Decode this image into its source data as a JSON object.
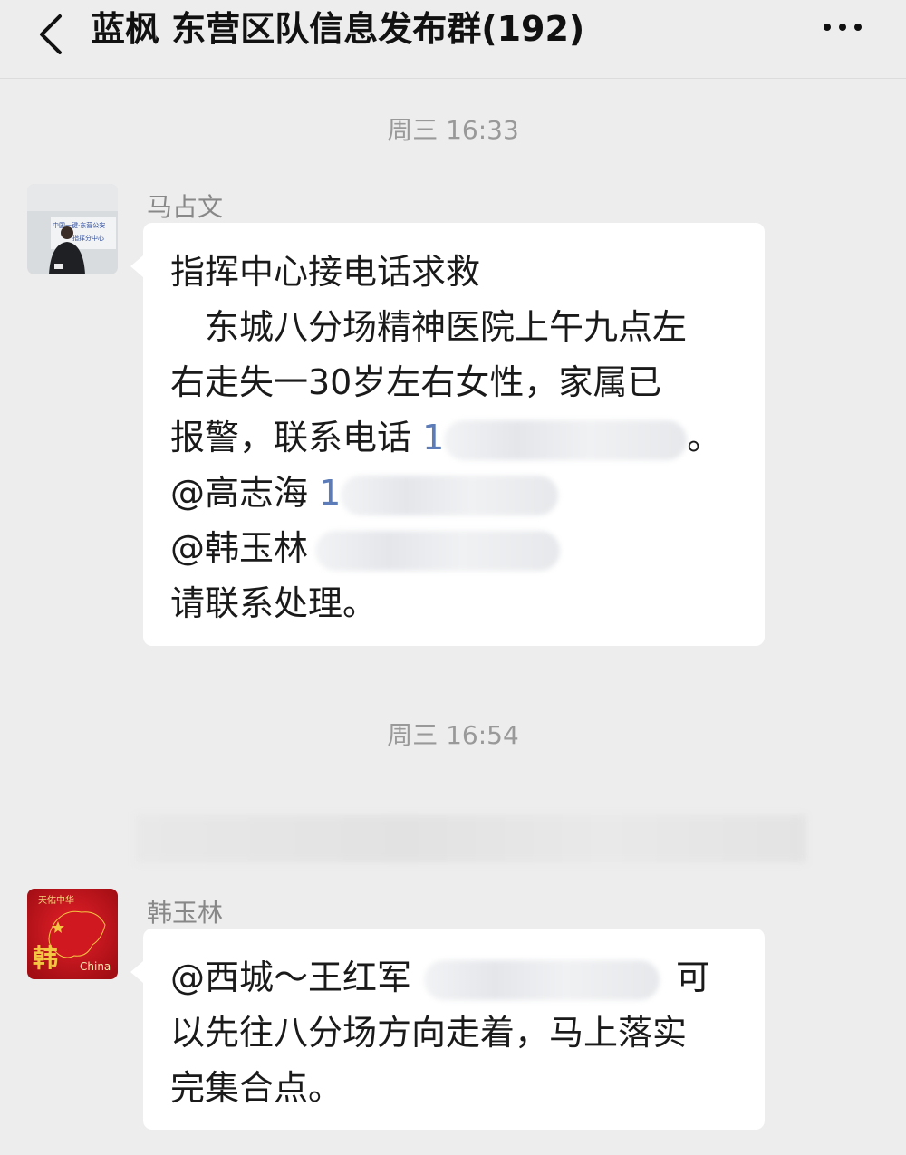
{
  "header": {
    "title": "蓝枫 东营区队信息发布群(192)",
    "back_icon": "chevron-left-icon",
    "more_icon": "more-dots-icon"
  },
  "messages": [
    {
      "time": "周三 16:33",
      "sender": "马占文",
      "avatar_text": [
        "中国一键·东营公安",
        "指挥分中心"
      ],
      "lines": [
        "指挥中心接电话求救",
        "　东城八分场精神医院上午九点左",
        "右走失一30岁左右女性，家属已",
        "报警，联系电话",
        "1",
        "。",
        " @高志海",
        "1",
        "  @韩玉林",
        " 请联系处理。"
      ]
    },
    {
      "time": "周三 16:54"
    },
    {
      "sender": "韩玉林",
      "avatar_text": [
        "天佑中华",
        "韩",
        "China"
      ],
      "lines": [
        "@西城～王红军",
        "可",
        "以先往八分场方向走着，马上落实",
        "完集合点。"
      ]
    }
  ],
  "colors": {
    "background": "#ededed",
    "bubble": "#ffffff",
    "link_blue": "#5b7cb8",
    "avatar_red": "#c8141c"
  }
}
